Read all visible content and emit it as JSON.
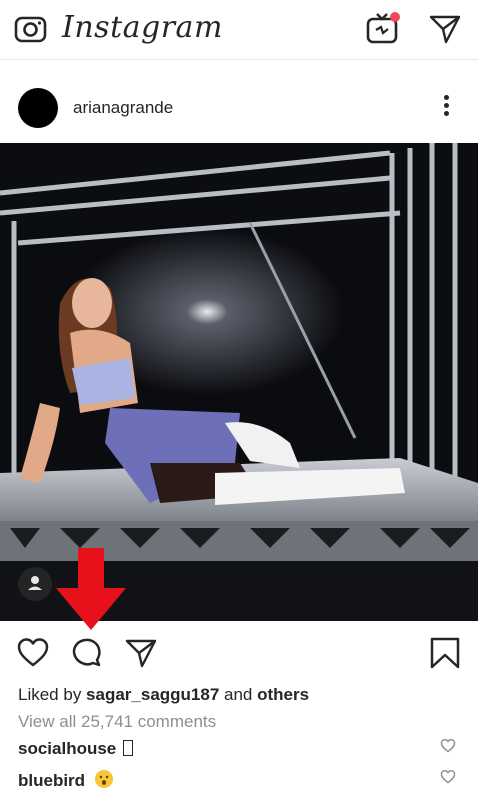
{
  "app": {
    "logo_text": "Instagram",
    "icons": {
      "camera": "camera-icon",
      "igtv": "igtv-icon",
      "direct": "paper-plane-icon"
    },
    "igtv_badge_color": "#ed4956"
  },
  "post": {
    "username": "arianagrande",
    "options_icon": "more-vertical-icon",
    "photo_description_icon": "photo",
    "user_tag_icon": "person-icon"
  },
  "annotation": {
    "arrow_color": "#e8101a",
    "arrow_icon": "down-arrow-icon"
  },
  "actions": {
    "like_icon": "heart-icon",
    "comment_icon": "comment-icon",
    "share_icon": "paper-plane-icon",
    "save_icon": "bookmark-icon"
  },
  "likes": {
    "prefix": "Liked by ",
    "user": "sagar_saggu187",
    "middle": " and ",
    "others": "others"
  },
  "view_all_comments": "View all 25,741 comments",
  "comments": [
    {
      "username": "socialhouse",
      "text": ""
    },
    {
      "username": "bluebird",
      "text": ""
    }
  ]
}
